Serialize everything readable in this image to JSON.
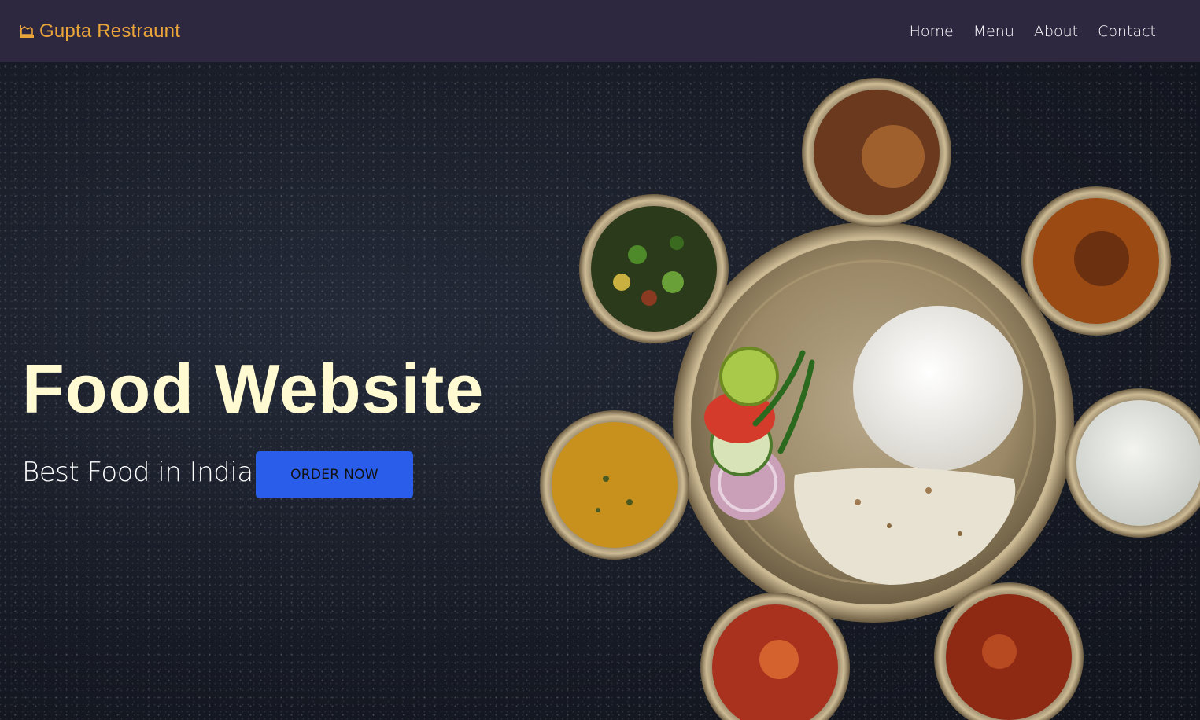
{
  "brand": {
    "name": "Gupta Restraunt",
    "icon": "chef-hat-icon",
    "color": "#e9a43a"
  },
  "nav": {
    "items": [
      "Home",
      "Menu",
      "About",
      "Contact"
    ]
  },
  "hero": {
    "title": "Food Website",
    "subtitle": "Best Food in India",
    "cta_label": "ORDER NOW",
    "cta_color": "#2a5eea",
    "title_color": "#fffad2"
  }
}
